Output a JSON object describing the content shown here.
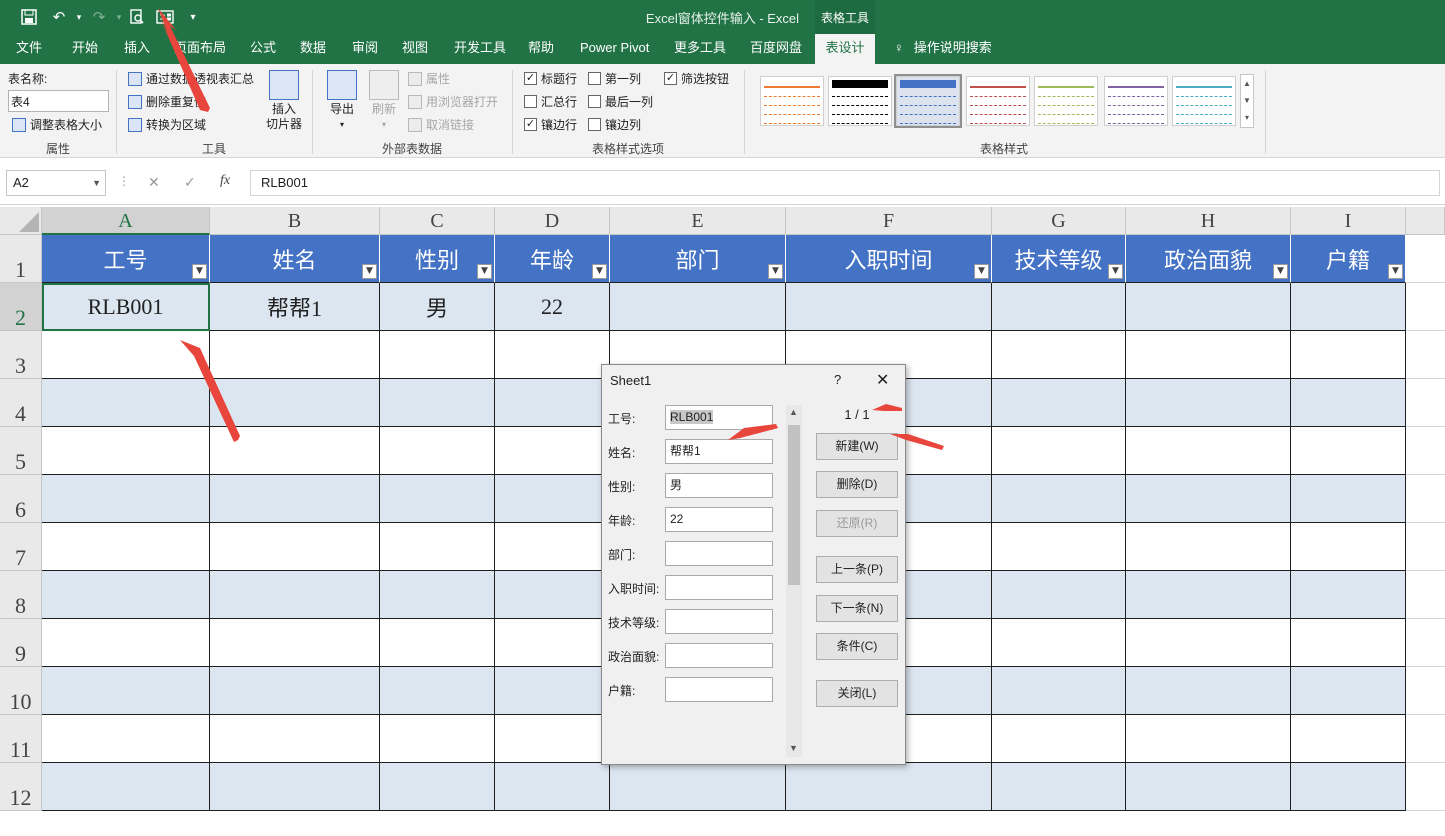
{
  "titlebar": {
    "title": "Excel窗体控件输入  -  Excel",
    "context_tab": "表格工具"
  },
  "tabs": [
    "文件",
    "开始",
    "插入",
    "页面布局",
    "公式",
    "数据",
    "审阅",
    "视图",
    "开发工具",
    "帮助",
    "Power Pivot",
    "更多工具",
    "百度网盘",
    "表设计",
    "操作说明搜索"
  ],
  "ribbon": {
    "props": {
      "table_name_label": "表名称:",
      "table_name": "表4",
      "resize": "调整表格大小",
      "group": "属性"
    },
    "tools": {
      "pivot": "通过数据透视表汇总",
      "dedupe": "删除重复值",
      "convert": "转换为区域",
      "slicer": "插入\n切片器",
      "group": "工具"
    },
    "ext": {
      "export": "导出",
      "refresh": "刷新",
      "props": "属性",
      "browser": "用浏览器打开",
      "unlink": "取消链接",
      "group": "外部表数据"
    },
    "opts": {
      "header_row": "标题行",
      "total_row": "汇总行",
      "banded_rows": "镶边行",
      "first_col": "第一列",
      "last_col": "最后一列",
      "banded_cols": "镶边列",
      "filter_btn": "筛选按钮",
      "group": "表格样式选项"
    },
    "styles": {
      "group": "表格样式",
      "colors": [
        "#ed7d31",
        "#000000",
        "#4472c4",
        "#c0504d",
        "#9bbb59",
        "#8064a2",
        "#4bacc6"
      ]
    }
  },
  "formula": {
    "cell": "A2",
    "value": "RLB001",
    "fx": "fx"
  },
  "columns": [
    "A",
    "B",
    "C",
    "D",
    "E",
    "F",
    "G",
    "H",
    "I"
  ],
  "rows": [
    "1",
    "2",
    "3",
    "4",
    "5",
    "6",
    "7",
    "8",
    "9",
    "10",
    "11",
    "12"
  ],
  "table": {
    "headers": [
      "工号",
      "姓名",
      "性别",
      "年龄",
      "部门",
      "入职时间",
      "技术等级",
      "政治面貌",
      "户籍"
    ],
    "row2": [
      "RLB001",
      "帮帮1",
      "男",
      "22"
    ]
  },
  "dialog": {
    "title": "Sheet1",
    "help": "?",
    "close": "✕",
    "record": "1 / 1",
    "fields": [
      {
        "label": "工号:",
        "value": "RLB001"
      },
      {
        "label": "姓名:",
        "value": "帮帮1"
      },
      {
        "label": "性别:",
        "value": "男"
      },
      {
        "label": "年龄:",
        "value": "22"
      },
      {
        "label": "部门:",
        "value": ""
      },
      {
        "label": "入职时间:",
        "value": ""
      },
      {
        "label": "技术等级:",
        "value": ""
      },
      {
        "label": "政治面貌:",
        "value": ""
      },
      {
        "label": "户籍:",
        "value": ""
      }
    ],
    "buttons": {
      "new": "新建(W)",
      "delete": "删除(D)",
      "restore": "还原(R)",
      "prev": "上一条(P)",
      "next": "下一条(N)",
      "criteria": "条件(C)",
      "close": "关闭(L)"
    }
  }
}
